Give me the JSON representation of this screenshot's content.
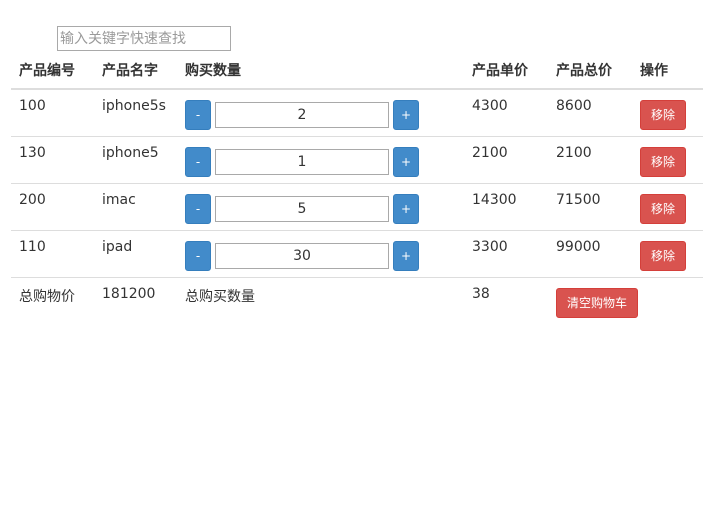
{
  "search": {
    "placeholder": "输入关键字快速查找"
  },
  "table": {
    "headers": [
      "产品编号",
      "产品名字",
      "购买数量",
      "产品单价",
      "产品总价",
      "操作"
    ],
    "rows": [
      {
        "id": "100",
        "name": "iphone5s",
        "qty": "2",
        "price": "4300",
        "total": "8600"
      },
      {
        "id": "130",
        "name": "iphone5",
        "qty": "1",
        "price": "2100",
        "total": "2100"
      },
      {
        "id": "200",
        "name": "imac",
        "qty": "5",
        "price": "14300",
        "total": "71500"
      },
      {
        "id": "110",
        "name": "ipad",
        "qty": "30",
        "price": "3300",
        "total": "99000"
      }
    ],
    "decrement_label": "-",
    "increment_label": "+",
    "remove_label": "移除"
  },
  "footer": {
    "total_price_label": "总购物价",
    "total_price": "181200",
    "total_qty_label": "总购买数量",
    "total_qty": "38",
    "clear_label": "清空购物车"
  },
  "colors": {
    "primary": "#428bca",
    "danger": "#d9534f",
    "border": "#dddddd"
  }
}
